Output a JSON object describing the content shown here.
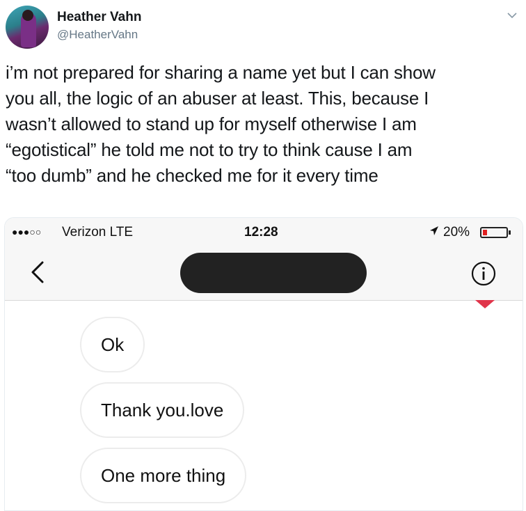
{
  "tweet": {
    "author_name": "Heather Vahn",
    "author_handle": "@HeatherVahn",
    "text_lines": [
      "i’m not prepared for sharing a name yet but I can show",
      "you all, the logic of an abuser  at least. This, because I",
      "wasn’t allowed to stand up for myself otherwise I am",
      "“egotistical” he told me not to try to think cause I am",
      "“too dumb” and he checked me for it every time"
    ]
  },
  "screenshot": {
    "status_bar": {
      "signal": "●●●○○",
      "carrier": "Verizon  LTE",
      "time": "12:28",
      "battery_text": "20%",
      "battery_level": 0.2
    },
    "conversation": {
      "contact_name": "[redacted]",
      "messages": [
        {
          "text": "Ok"
        },
        {
          "text": "Thank you.love"
        },
        {
          "text": "One more thing"
        }
      ]
    },
    "colors": {
      "battery_low": "#e02020",
      "marker": "#e0344a"
    }
  },
  "icons": {
    "caret": "chevron-down-icon",
    "back": "chevron-left-icon",
    "info": "info-icon",
    "location": "location-arrow-icon"
  }
}
